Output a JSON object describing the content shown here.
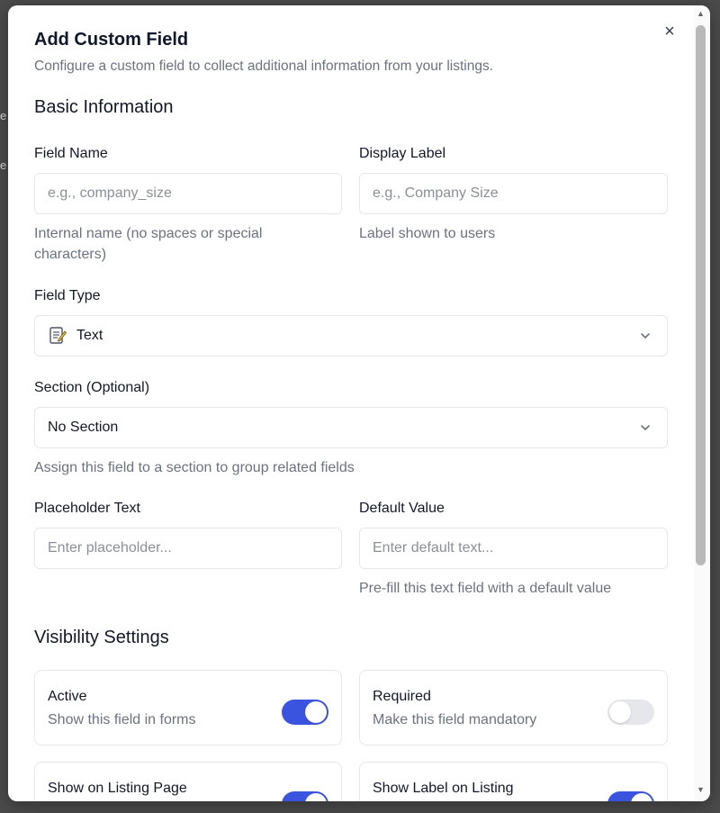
{
  "modal": {
    "title": "Add Custom Field",
    "subtitle": "Configure a custom field to collect additional information from your listings.",
    "close_icon": "×"
  },
  "basic_info": {
    "heading": "Basic Information",
    "field_name": {
      "label": "Field Name",
      "placeholder": "e.g., company_size",
      "value": "",
      "help": "Internal name (no spaces or special characters)"
    },
    "display_label": {
      "label": "Display Label",
      "placeholder": "e.g., Company Size",
      "value": "",
      "help": "Label shown to users"
    },
    "field_type": {
      "label": "Field Type",
      "selected": "Text",
      "icon": "text-document-icon"
    },
    "section": {
      "label": "Section (Optional)",
      "selected": "No Section",
      "help": "Assign this field to a section to group related fields"
    },
    "placeholder_text": {
      "label": "Placeholder Text",
      "placeholder": "Enter placeholder...",
      "value": ""
    },
    "default_value": {
      "label": "Default Value",
      "placeholder": "Enter default text...",
      "value": "",
      "help": "Pre-fill this text field with a default value"
    }
  },
  "visibility": {
    "heading": "Visibility Settings",
    "cards": [
      {
        "title": "Active",
        "description": "Show this field in forms",
        "enabled": true
      },
      {
        "title": "Required",
        "description": "Make this field mandatory",
        "enabled": false
      },
      {
        "title": "Show on Listing Page",
        "description": "",
        "enabled": true
      },
      {
        "title": "Show Label on Listing",
        "description": "",
        "enabled": true
      }
    ]
  },
  "colors": {
    "accent": "#3b54e0",
    "toggle_off": "#e5e7eb",
    "muted_text": "#6b7280"
  },
  "backdrop": {
    "text_1": "e",
    "text_2": "e"
  }
}
